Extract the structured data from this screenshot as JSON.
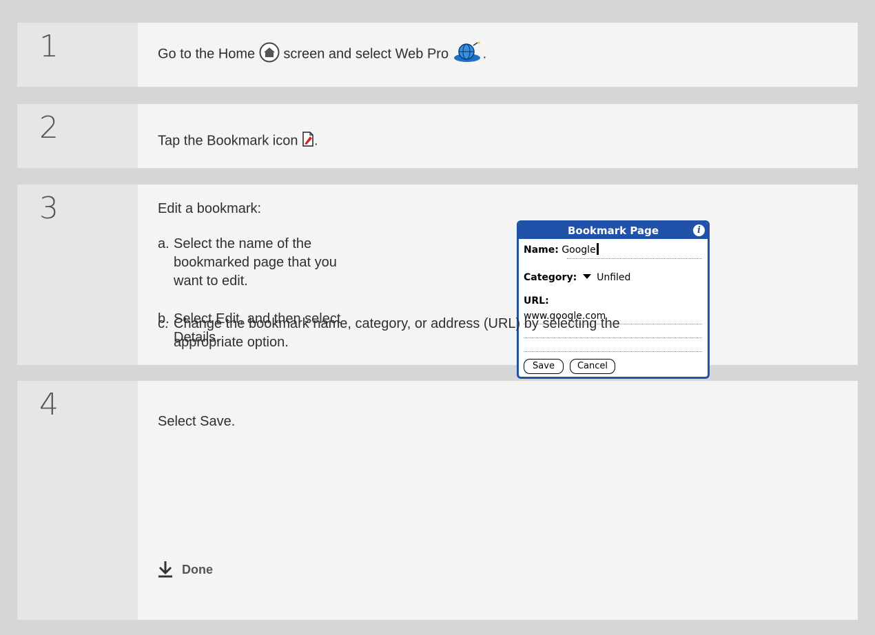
{
  "steps": [
    {
      "number": "1",
      "text_before": "Go to the Home",
      "text_middle": "screen and select Web Pro",
      "text_after": "."
    },
    {
      "number": "2",
      "text_before": "Tap the Bookmark icon",
      "text_after": "."
    },
    {
      "number": "3",
      "intro": "Edit a bookmark:",
      "substeps": [
        {
          "label": "a.",
          "lines": [
            "Select the name of the",
            "bookmarked page that you",
            "want to edit."
          ]
        },
        {
          "label": "b.",
          "lines": [
            "Select Edit, and then select",
            "Details."
          ]
        },
        {
          "label": "c.",
          "lines": [
            "Change the bookmark name, category, or address (URL) by selecting the",
            "appropriate option."
          ]
        }
      ]
    },
    {
      "number": "4",
      "text": "Select Save.",
      "done_label": "Done"
    }
  ],
  "dialog": {
    "title": "Bookmark Page",
    "name_label": "Name:",
    "name_value": "Google",
    "category_label": "Category:",
    "category_value": "Unfiled",
    "url_label": "URL:",
    "url_value": "www.google.com",
    "save_label": "Save",
    "cancel_label": "Cancel",
    "info_glyph": "i"
  },
  "icons": {
    "home": "home-icon",
    "web_pro": "web-pro-globe-icon",
    "bookmark": "bookmark-icon",
    "done": "done-arrow-icon"
  },
  "colors": {
    "dialog_accent": "#1f52a8",
    "bookmark_red": "#d8232a"
  }
}
